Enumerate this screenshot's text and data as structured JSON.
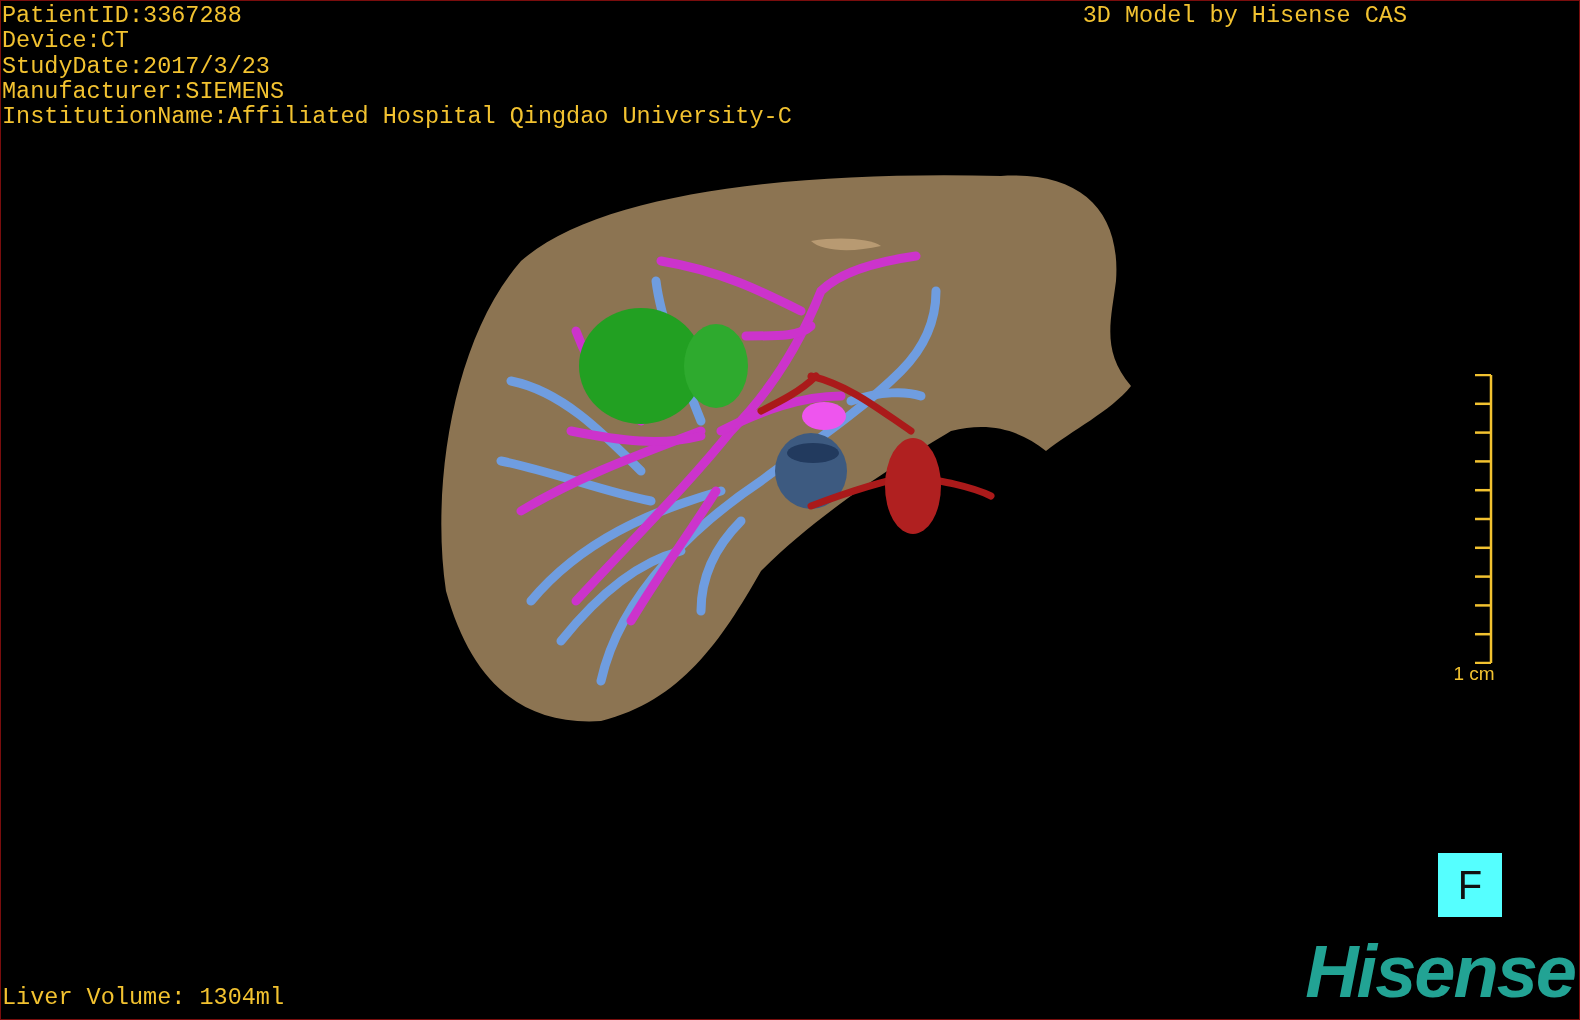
{
  "info_lines": [
    "PatientID:3367288",
    "Device:CT",
    "StudyDate:2017/3/23",
    "Manufacturer:SIEMENS",
    "InstitutionName:Affiliated Hospital Qingdao University-C"
  ],
  "title": "3D Model by Hisense CAS",
  "scale_bar": {
    "label": "1 cm"
  },
  "orientation_button": "F",
  "liver_volume": "Liver Volume: 1304ml",
  "logo": "Hisense"
}
